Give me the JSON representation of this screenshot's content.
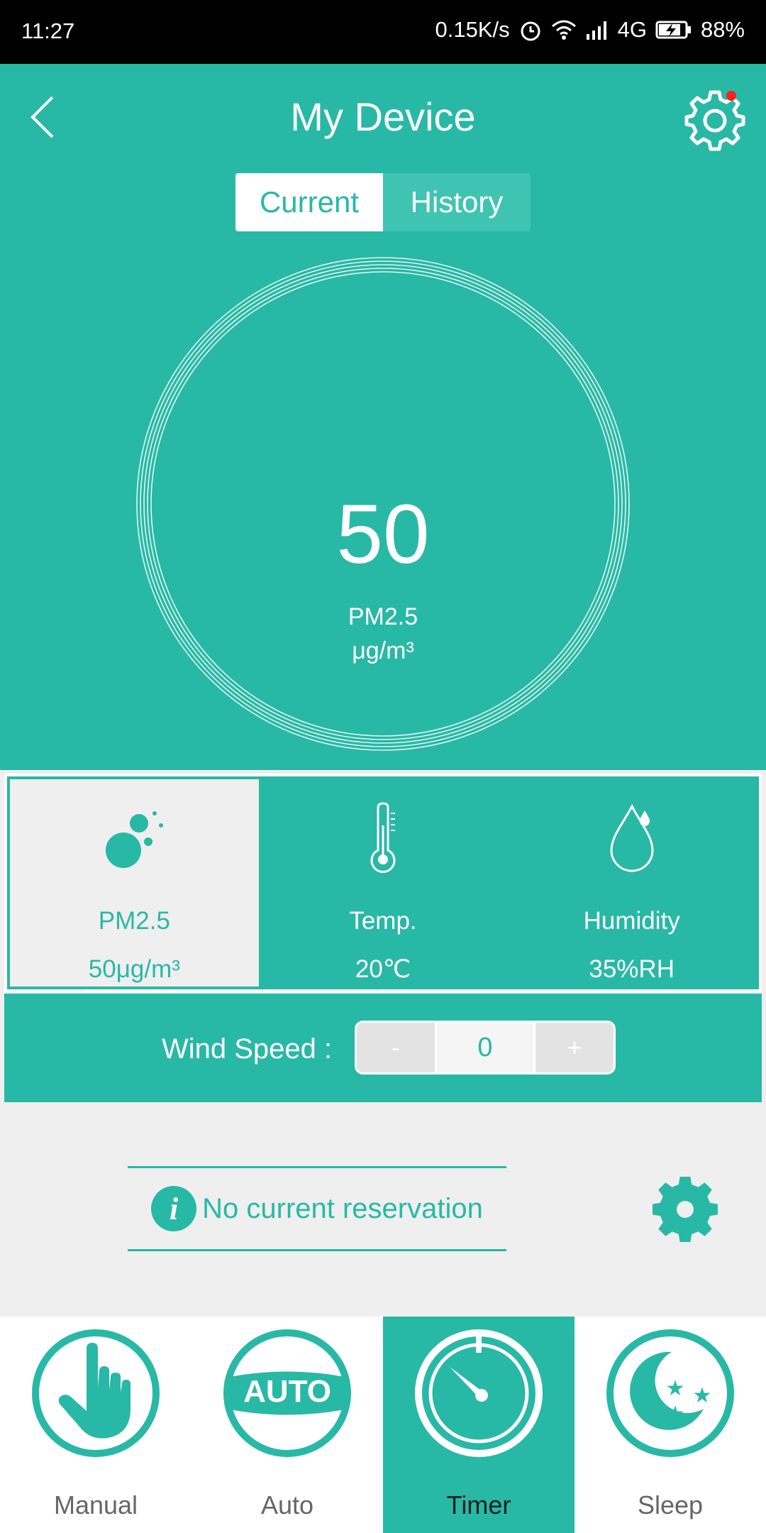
{
  "status_bar": {
    "time": "11:27",
    "net_speed": "0.15K/s",
    "network": "4G",
    "battery": "88%"
  },
  "header": {
    "title": "My Device",
    "tabs": [
      {
        "label": "Current",
        "active": true
      },
      {
        "label": "History",
        "active": false
      }
    ]
  },
  "gauge": {
    "value": "50",
    "label": "PM2.5",
    "unit": "μg/m³"
  },
  "metrics": [
    {
      "name": "PM2.5",
      "value": "50μg/m³",
      "icon": "particles-icon",
      "selected": true
    },
    {
      "name": "Temp.",
      "value": "20℃",
      "icon": "thermometer-icon",
      "selected": false
    },
    {
      "name": "Humidity",
      "value": "35%RH",
      "icon": "droplet-icon",
      "selected": false
    }
  ],
  "wind": {
    "label": "Wind Speed :",
    "minus": "-",
    "value": "0",
    "plus": "+"
  },
  "reservation": {
    "info_glyph": "i",
    "text": "No current reservation"
  },
  "bottom_nav": [
    {
      "label": "Manual",
      "icon": "hand-icon",
      "active": false
    },
    {
      "label": "Auto",
      "icon": "auto-icon",
      "active": false
    },
    {
      "label": "Timer",
      "icon": "timer-icon",
      "active": true
    },
    {
      "label": "Sleep",
      "icon": "moon-stars-icon",
      "active": false
    }
  ],
  "colors": {
    "accent": "#28b8a6",
    "background": "#efefef",
    "notification_dot": "#ff1f1f"
  }
}
